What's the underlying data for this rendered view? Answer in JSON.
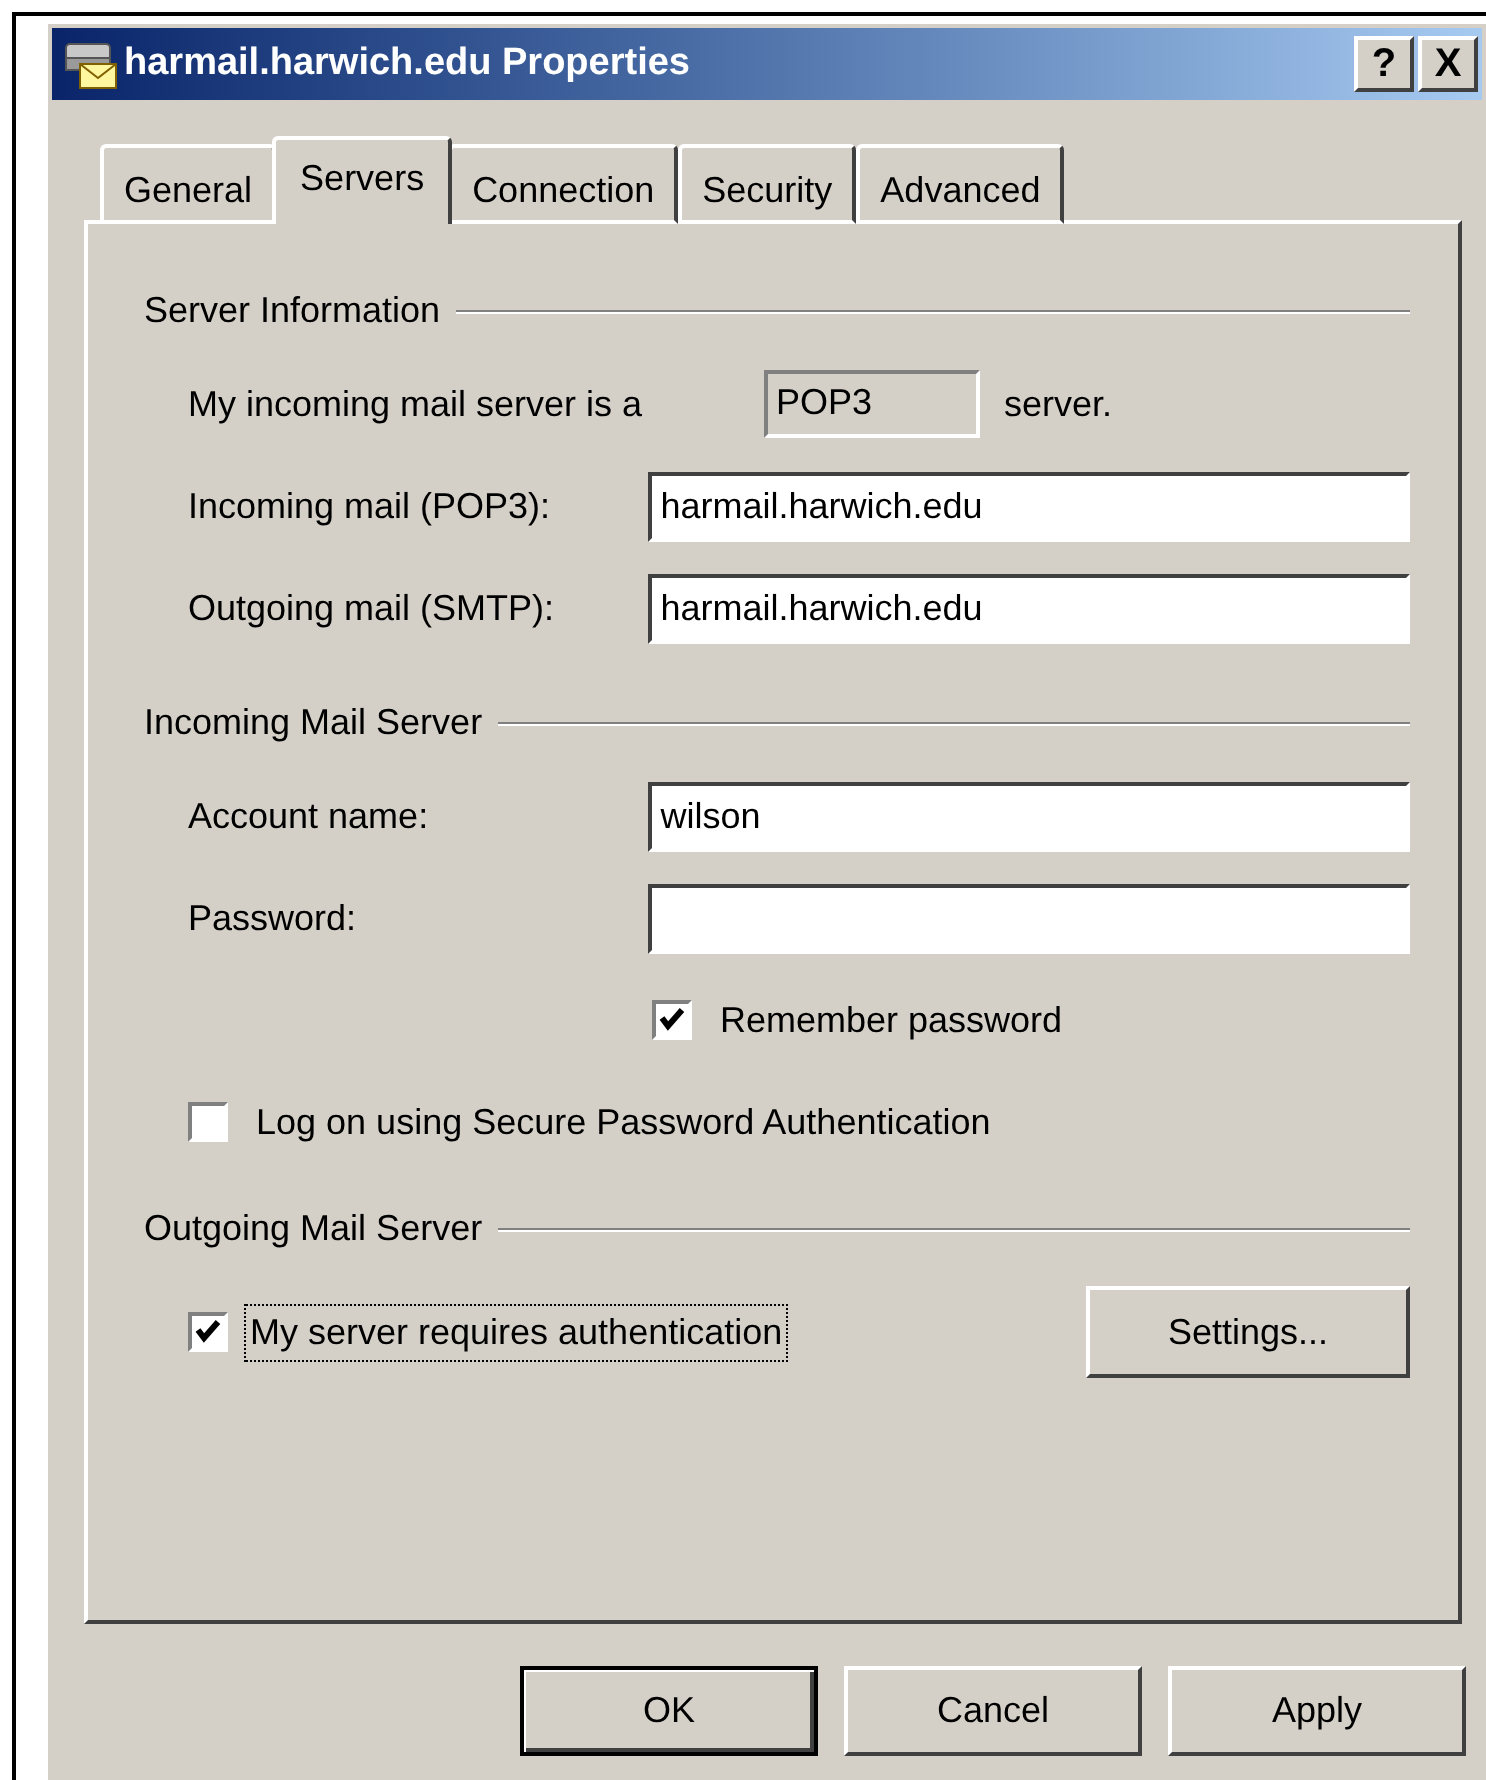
{
  "window": {
    "title": "harmail.harwich.edu Properties",
    "title_buttons": [
      "?",
      "X"
    ]
  },
  "tabs": [
    {
      "label": "General",
      "selected": false
    },
    {
      "label": "Servers",
      "selected": true
    },
    {
      "label": "Connection",
      "selected": false
    },
    {
      "label": "Security",
      "selected": false
    },
    {
      "label": "Advanced",
      "selected": false
    }
  ],
  "sections": [
    {
      "title": "Server Information",
      "rows": [
        {
          "kind": "info",
          "label": "My incoming mail server is a",
          "value": "POP3",
          "suffix": "server."
        },
        {
          "kind": "field",
          "label": "Incoming mail (POP3):",
          "value": "harmail.harwich.edu"
        },
        {
          "kind": "field",
          "label": "Outgoing mail (SMTP):",
          "value": "harmail.harwich.edu"
        }
      ]
    },
    {
      "title": "Incoming Mail Server",
      "rows": [
        {
          "kind": "field",
          "label": "Account name:",
          "value": "wilson"
        },
        {
          "kind": "field",
          "label": "Password:"
        },
        {
          "kind": "sub_checkbox",
          "label": "Remember password",
          "checked": true
        },
        {
          "kind": "checkbox",
          "label": "Log on using Secure Password Authentication",
          "checked": false
        }
      ]
    },
    {
      "title": "Outgoing Mail Server",
      "rows": [
        {
          "kind": "checkbox_button",
          "label": "My server requires authentication",
          "checked": true,
          "focused": true,
          "button": "Settings..."
        }
      ]
    }
  ],
  "buttons": [
    {
      "label": "OK",
      "default": true
    },
    {
      "label": "Cancel",
      "default": false
    },
    {
      "label": "Apply",
      "default": false
    }
  ]
}
